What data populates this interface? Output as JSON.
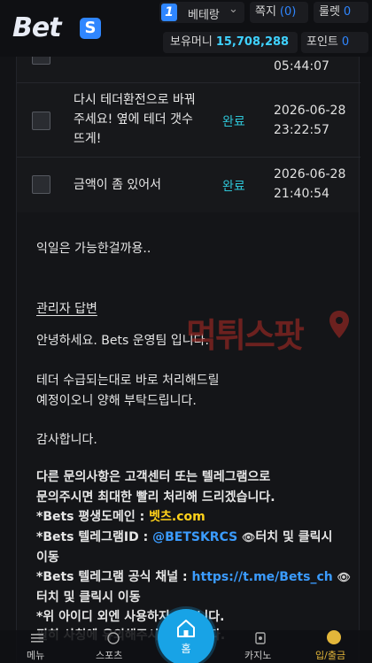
{
  "header": {
    "logo_text": "Bet",
    "logo_badge": "S",
    "rank_number": "1",
    "rank_label": "베테랑",
    "messages_label": "쪽지",
    "messages_count": "(0)",
    "roulette_label": "룰렛",
    "roulette_count": "0",
    "money_label": "보유머니",
    "money_value": "15,708,288",
    "points_label": "포인트",
    "points_value": "0"
  },
  "table": {
    "rows": [
      {
        "title": "",
        "status": "",
        "date": "",
        "time": "05:44:07"
      },
      {
        "title": "다시 테더환전으로 바꿔주세요! 옆에 테더 갯수 뜨게!",
        "title_l1": "다시 테더환전으로 바꿔",
        "title_l2": "주세요! 옆에 테더 갯수",
        "title_l3": "뜨게!",
        "status": "완료",
        "date": "2026-06-28",
        "time": "23:22:57"
      },
      {
        "title": "금액이 좀 있어서",
        "status": "완료",
        "date": "2026-06-28",
        "time": "21:40:54"
      }
    ]
  },
  "content": {
    "question": "익일은 가능한걸까용..",
    "admin_heading": "관리자 답변",
    "greeting": "안녕하세요. Bets 운영팀 입니다.",
    "reply_l1": "테더 수급되는대로 바로 처리해드릴",
    "reply_l2": "예정이오니 양해 부탁드립니다.",
    "thanks": "감사합니다.",
    "notice_l1": "다른 문의사항은 고객센터 또는 텔레그램으로",
    "notice_l2": "문의주시면 최대한 빨리 처리해 드리겠습니다.",
    "domain_label": "*Bets 평생도메인 : ",
    "domain_value": "벳츠.com",
    "tg_id_label": "*Bets 텔레그램ID : ",
    "tg_id_value": "@BETSKRCS",
    "tg_id_suffix": "터치 및 클릭시",
    "tg_id_l2": "이동",
    "tg_channel_label": "*Bets 텔레그램 공식 채널 : ",
    "tg_channel_value": "https://t.me/Bets_ch",
    "tg_channel_l2": "터치 및 클릭시 이동",
    "warn_l1": "*위 아이디 외엔 사용하지 않습니다.",
    "warn_l2": "필히 사칭에 유의해주시기 바랍니다."
  },
  "watermark": {
    "text": "먹튀스팟"
  },
  "bottom_nav": {
    "menu": "메뉴",
    "sports": "스포츠",
    "home": "홈",
    "casino": "카지노",
    "deposit": "입/출금"
  },
  "colors": {
    "accent_blue": "#2f86ff",
    "status_teal": "#2ec4d6",
    "money_cyan": "#3fd2ff",
    "highlight_yellow": "#ffd21a",
    "home_button": "#18a3e6"
  }
}
